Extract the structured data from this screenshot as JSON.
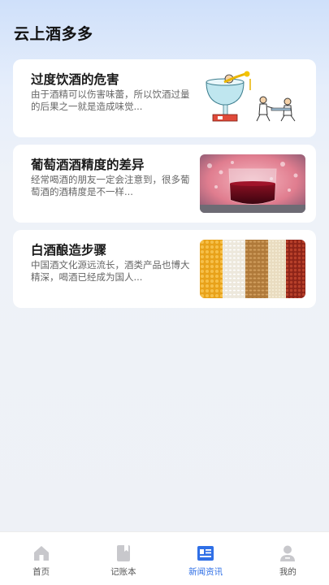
{
  "app": {
    "title": "云上酒多多"
  },
  "articles": [
    {
      "title": "过度饮酒的危害",
      "description": "由于酒精可以伤害味蕾，所以饮酒过量的后果之一就是造成味觉...",
      "image": "cartoon-drinking-illustration"
    },
    {
      "title": "葡萄酒酒精度的差异",
      "description": "经常喝酒的朋友一定会注意到，很多葡萄酒的酒精度是不一样...",
      "image": "red-wine-glass-photo"
    },
    {
      "title": "白酒酿造步骤",
      "description": "中国酒文化源远流长，酒类产品也博大精深，喝酒已经成为国人...",
      "image": "grains-photo"
    }
  ],
  "tabbar": {
    "active": "新闻资讯",
    "active_color": "#2f6fe6",
    "items": [
      {
        "label": "首页",
        "icon": "home-icon"
      },
      {
        "label": "记账本",
        "icon": "book-icon"
      },
      {
        "label": "新闻资讯",
        "icon": "news-icon"
      },
      {
        "label": "我的",
        "icon": "user-icon"
      }
    ]
  }
}
